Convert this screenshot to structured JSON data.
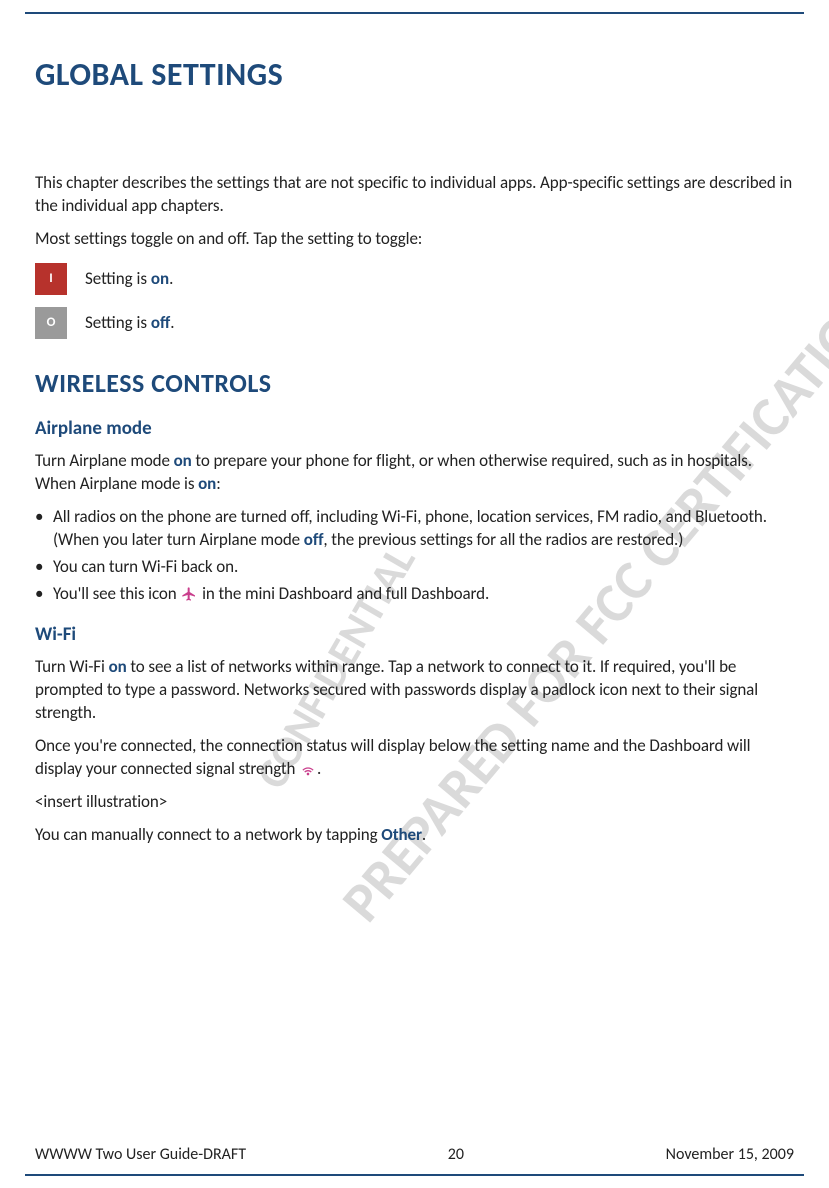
{
  "title": "GLOBAL SETTINGS",
  "intro_p1": "This chapter describes the settings that are not specific to individual apps. App-specific settings are described in the individual app chapters.",
  "intro_p2": "Most settings toggle on and off. Tap the setting to toggle:",
  "toggle_on_symbol": "I",
  "toggle_on_prefix": "Setting is ",
  "toggle_on_word": "on",
  "toggle_on_suffix": ".",
  "toggle_off_symbol": "O",
  "toggle_off_prefix": "Setting is ",
  "toggle_off_word": "off",
  "toggle_off_suffix": ".",
  "h2_wireless": "WIRELESS CONTROLS",
  "h3_airplane": "Airplane mode",
  "airplane_p1_a": "Turn Airplane mode ",
  "airplane_p1_b": "on",
  "airplane_p1_c": " to prepare your phone for flight, or when otherwise required, such as in hospitals. When Airplane mode is ",
  "airplane_p1_d": "on",
  "airplane_p1_e": ":",
  "airplane_li1_a": "All radios on the phone are turned off, including Wi-Fi, phone, location services, FM radio, and Bluetooth. (When you later turn Airplane mode ",
  "airplane_li1_b": "off",
  "airplane_li1_c": ", the previous settings for all the radios are restored.)",
  "airplane_li2": "You can turn Wi-Fi back on.",
  "airplane_li3_a": "You'll see this icon ",
  "airplane_li3_b": " in the mini Dashboard and full Dashboard.",
  "h3_wifi": "Wi-Fi",
  "wifi_p1_a": "Turn Wi-Fi ",
  "wifi_p1_b": "on",
  "wifi_p1_c": " to see a list of networks within range. Tap a network to connect to it. If required, you'll be prompted to type a password. Networks secured with passwords display a padlock icon next to their signal strength.",
  "wifi_p2_a": "Once you're connected, the connection status will display below the setting name and the Dashboard will display your connected signal strength ",
  "wifi_p2_b": ".",
  "wifi_p3": "<insert illustration>",
  "wifi_p4_a": "You can manually connect to a network by tapping ",
  "wifi_p4_b": "Other",
  "wifi_p4_c": ".",
  "footer_left": "WWWW Two User Guide-DRAFT",
  "footer_center": "20",
  "footer_right": "November 15, 2009",
  "watermark1": "PREPARED FOR FCC CERTIFICATION",
  "watermark2": "CONFIDENTIAL"
}
